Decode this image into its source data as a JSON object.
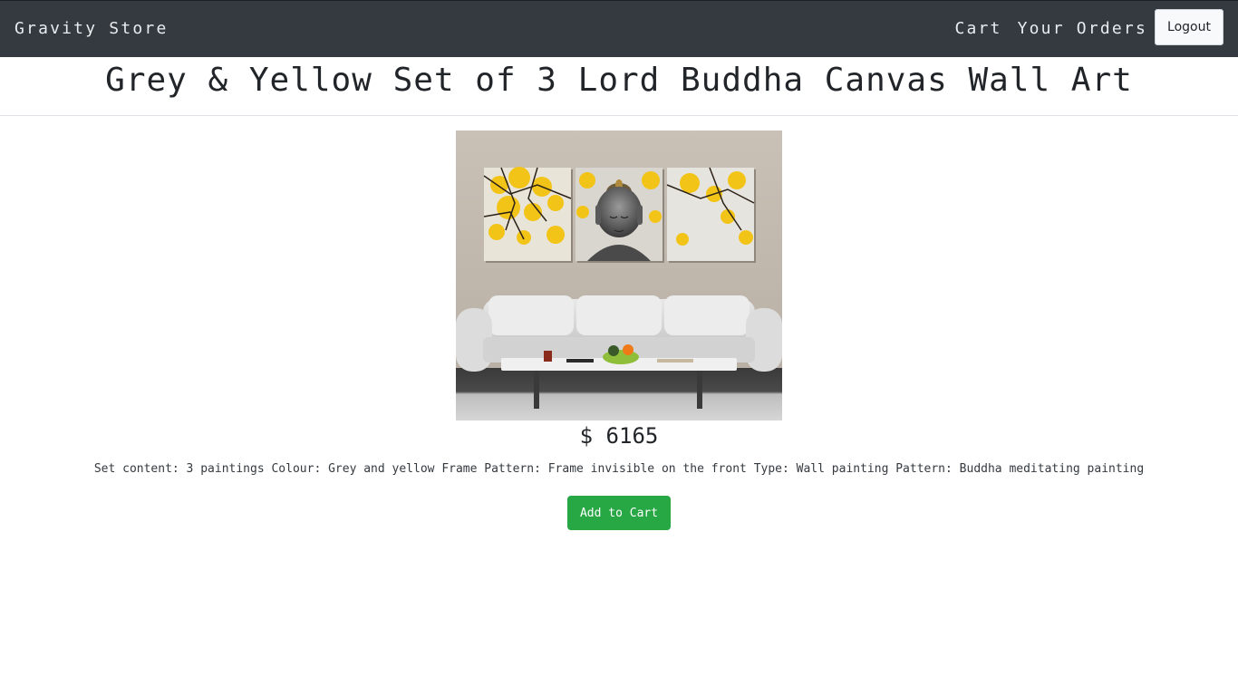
{
  "navbar": {
    "brand": "Gravity Store",
    "links": [
      {
        "label": "Cart"
      },
      {
        "label": "Your Orders"
      }
    ],
    "logout_label": "Logout"
  },
  "product": {
    "title": "Grey & Yellow Set of 3 Lord Buddha Canvas Wall Art",
    "price": "$ 6165",
    "description": "Set content: 3 paintings Colour: Grey and yellow Frame Pattern: Frame invisible on the front Type: Wall painting Pattern: Buddha meditating painting",
    "add_to_cart_label": "Add to Cart"
  },
  "colors": {
    "navbar_bg": "#343a40",
    "accent_green": "#28a745"
  }
}
